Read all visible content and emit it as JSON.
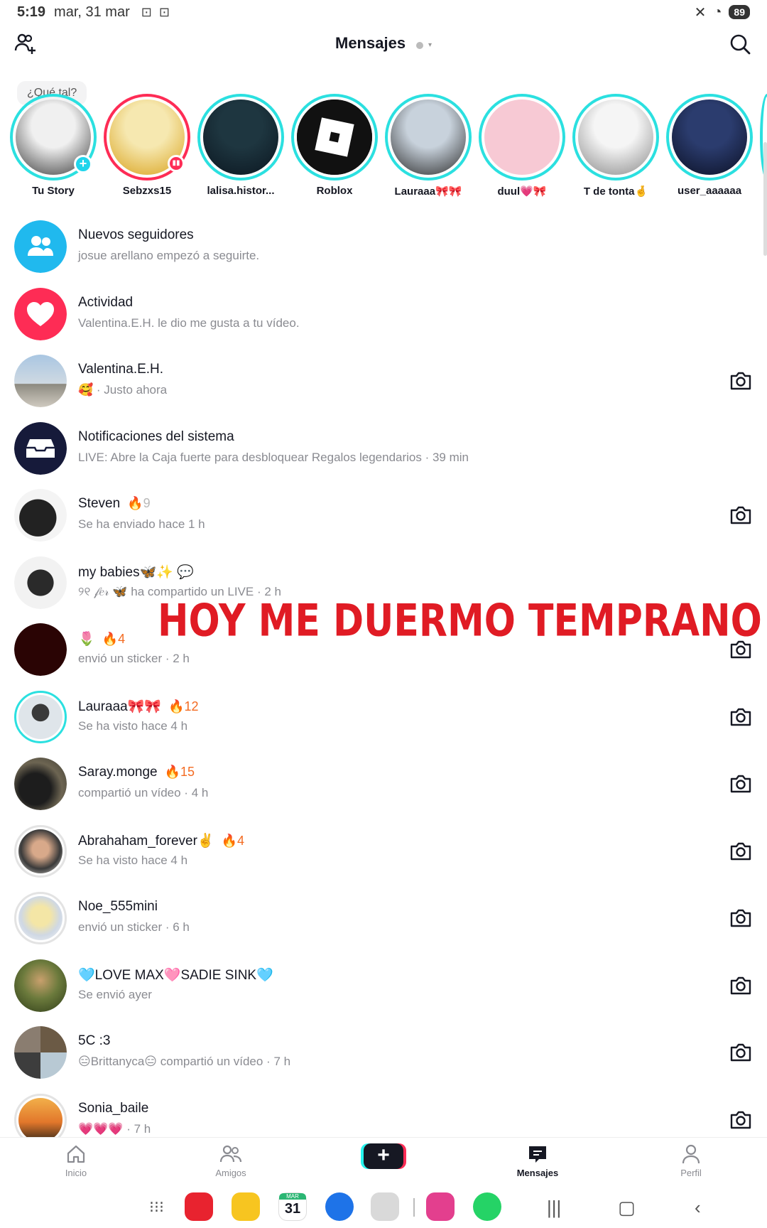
{
  "status_bar": {
    "time": "5:19",
    "date": "mar, 31 mar",
    "battery": "89"
  },
  "header": {
    "title": "Mensajes"
  },
  "stories": {
    "bubble": "¿Qué tal?",
    "items": [
      {
        "name": "Tu Story",
        "colors": [
          "#f0f0f0",
          "#3a3a3a"
        ]
      },
      {
        "name": "Sebzxs15",
        "colors": [
          "#f6e8b0",
          "#d9a21b"
        ]
      },
      {
        "name": "lalisa.histor...",
        "colors": [
          "#1e3640",
          "#0b1620"
        ]
      },
      {
        "name": "Roblox",
        "colors": [
          "#111111",
          "#111111"
        ]
      },
      {
        "name": "Lauraaa🎀🎀",
        "colors": [
          "#c8d2dc",
          "#2a2a2a"
        ]
      },
      {
        "name": "duul💗🎀",
        "colors": [
          "#f7c9d4",
          "#f7c9d4"
        ]
      },
      {
        "name": "T de tonta🤞",
        "colors": [
          "#f5f5f5",
          "#888888"
        ]
      },
      {
        "name": "user_aaaaaa",
        "colors": [
          "#2b3c6e",
          "#0b1024"
        ]
      }
    ]
  },
  "conversations": [
    {
      "title": "Nuevos seguidores",
      "sub": "josue arellano empezó a seguirte.",
      "streak": "",
      "camera": false
    },
    {
      "title": "Actividad",
      "sub": "Valentina.E.H. le dio me gusta a tu vídeo.",
      "streak": "",
      "camera": false
    },
    {
      "title": "Valentina.E.H.",
      "sub": "🥰 · Justo ahora",
      "streak": "",
      "camera": true
    },
    {
      "title": "Notificaciones del sistema",
      "sub": "LIVE: Abre la Caja fuerte para desbloquear Regalos legendarios · 39 min",
      "streak": "",
      "camera": false
    },
    {
      "title": "Steven",
      "sub": "Se ha enviado hace 1 h",
      "streak": "🔥9",
      "camera": true
    },
    {
      "title": "my babies🦋✨ 💬",
      "sub": "୨୧ 𝒻𝑒𝓇 🦋 ha compartido un LIVE · 2 h",
      "streak": "",
      "camera": false
    },
    {
      "title": "🌷",
      "sub": "envió un sticker · 2 h",
      "streak": "🔥4",
      "camera": true
    },
    {
      "title": "Lauraaa🎀🎀",
      "sub": "Se ha visto hace 4 h",
      "streak": "🔥12",
      "camera": true
    },
    {
      "title": "Saray.monge",
      "sub": "compartió un vídeo · 4 h",
      "streak": "🔥15",
      "camera": true
    },
    {
      "title": "Abrahaham_forever✌️",
      "sub": "Se ha visto hace 4 h",
      "streak": "🔥4",
      "camera": true
    },
    {
      "title": "Noe_555mini",
      "sub": "envió un sticker · 6 h",
      "streak": "",
      "camera": true
    },
    {
      "title": "🩵LOVE MAX🩷SADIE SINK🩵",
      "sub": "Se envió ayer",
      "streak": "",
      "camera": true
    },
    {
      "title": "5C :3",
      "sub": "😑Brittanyca😑 compartió un vídeo · 7 h",
      "streak": "",
      "camera": true
    },
    {
      "title": "Sonia_baile",
      "sub": "💗💗💗 · 7 h",
      "streak": "",
      "camera": true
    }
  ],
  "overlay_text": "HOY ME DUERMO TEMPRANO",
  "bottom_nav": {
    "home": "Inicio",
    "friends": "Amigos",
    "create": "+",
    "messages": "Mensajes",
    "profile": "Perfil"
  },
  "dock": {
    "calendar_day": "31",
    "calendar_month": "MAR"
  },
  "colors": {
    "accent_cyan": "#2be0e0",
    "accent_pink": "#fe2c55",
    "streak_orange": "#f36b22",
    "overlay_red": "#e01b24"
  }
}
